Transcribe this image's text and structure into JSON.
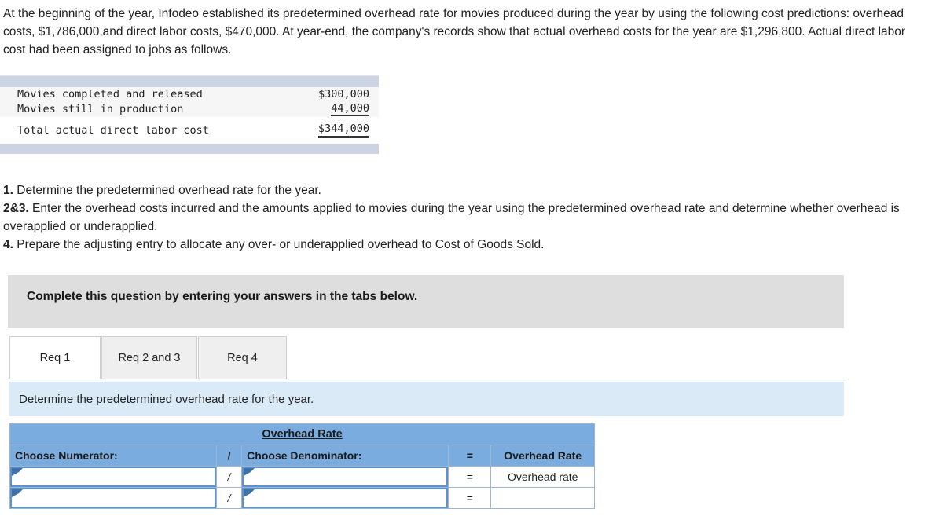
{
  "intro": {
    "paragraph": "At the beginning of the year, Infodeo established its predetermined overhead rate for movies produced during the year by using the following cost predictions: overhead costs, $1,786,000,and direct labor costs, $470,000. At year-end, the company's records show that actual overhead costs for the year are $1,296,800. Actual direct labor cost had been assigned to jobs as follows."
  },
  "facts_table": {
    "rows": [
      {
        "label": "Movies completed and released",
        "amount": "$300,000",
        "rule": "none"
      },
      {
        "label": "Movies still in production",
        "amount": "44,000",
        "rule": "single"
      },
      {
        "label": "Total actual direct labor cost",
        "amount": "$344,000",
        "rule": "double"
      }
    ]
  },
  "requirements": {
    "r1_num": "1.",
    "r1_text": " Determine the predetermined overhead rate for the year.",
    "r2_num": "2&3.",
    "r2_text": " Enter the overhead costs incurred and the amounts applied to movies during the year using the predetermined overhead rate and determine whether overhead is overapplied or underapplied.",
    "r3_num": "4.",
    "r3_text": " Prepare the adjusting entry to allocate any over- or underapplied overhead to Cost of Goods Sold."
  },
  "banner": {
    "text": "Complete this question by entering your answers in the tabs below."
  },
  "tabs": {
    "items": [
      {
        "label": "Req 1",
        "active": true
      },
      {
        "label": "Req 2 and 3",
        "active": false
      },
      {
        "label": "Req 4",
        "active": false
      }
    ]
  },
  "prompt": {
    "text": "Determine the predetermined overhead rate for the year."
  },
  "overhead_table": {
    "title": "Overhead Rate",
    "headers": {
      "numerator": "Choose Numerator:",
      "slash": "/",
      "denominator": "Choose Denominator:",
      "equals": "=",
      "rate": "Overhead Rate"
    },
    "rows": [
      {
        "numerator_value": "",
        "slash": "/",
        "denominator_value": "",
        "equals": "=",
        "rate_value": "Overhead rate"
      },
      {
        "numerator_value": "",
        "slash": "/",
        "denominator_value": "",
        "equals": "=",
        "rate_value": ""
      }
    ]
  },
  "colors": {
    "header_blue": "#7bacdf",
    "prompt_blue": "#dbeaf7",
    "banner_gray": "#dedede",
    "facts_bar": "#ccd3e3",
    "field_border": "#5f92c8"
  }
}
